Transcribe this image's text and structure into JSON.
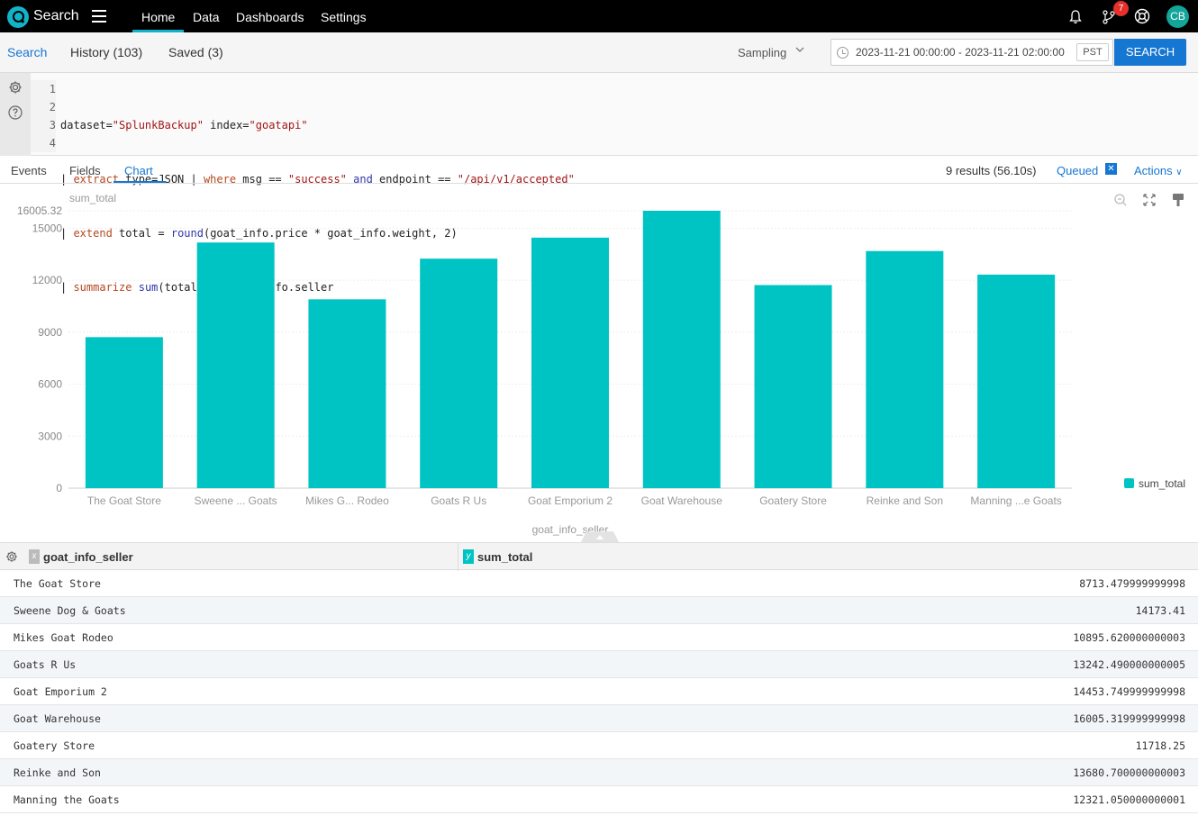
{
  "header": {
    "app_title": "Search",
    "nav": [
      "Home",
      "Data",
      "Dashboards",
      "Settings"
    ],
    "notification_count": "7",
    "avatar_initials": "CB"
  },
  "search_tabs": {
    "search": "Search",
    "history": "History (103)",
    "saved": "Saved (3)"
  },
  "sampling_label": "Sampling",
  "time_range": {
    "value": "2023-11-21 00:00:00 - 2023-11-21 02:00:00",
    "timezone": "PST"
  },
  "search_button": "SEARCH",
  "query": {
    "line_numbers": [
      "1",
      "2",
      "3",
      "4"
    ],
    "lines": [
      "dataset=\"SplunkBackup\" index=\"goatapi\"",
      "| extract type=JSON | where msg == \"success\" and endpoint == \"/api/v1/accepted\"",
      "| extend total = round(goat_info.price * goat_info.weight, 2)",
      "| summarize sum(total) by goat_info.seller"
    ]
  },
  "result_tabs": {
    "events": "Events",
    "fields": "Fields",
    "chart": "Chart"
  },
  "results_count": "9 results (56.10s)",
  "queued_label": "Queued",
  "actions_label": "Actions",
  "chart_data": {
    "type": "bar",
    "title": "",
    "xlabel": "goat_info_seller",
    "ylabel": "sum_total",
    "ylim": [
      0,
      16005.32
    ],
    "max_label": "16005.32",
    "y_ticks": [
      0,
      3000,
      6000,
      9000,
      12000,
      15000
    ],
    "categories": [
      "The Goat Store",
      "Sweene ... Goats",
      "Mikes G... Rodeo",
      "Goats R Us",
      "Goat Emporium 2",
      "Goat Warehouse",
      "Goatery Store",
      "Reinke and Son",
      "Manning ...e Goats"
    ],
    "series": [
      {
        "name": "sum_total",
        "values": [
          8713.48,
          14173.41,
          10895.62,
          13242.49,
          14453.75,
          16005.32,
          11718.25,
          13680.7,
          12321.05
        ]
      }
    ],
    "bar_color": "#00c4c4",
    "grid": true,
    "legend_position": "right"
  },
  "table": {
    "col_x_tag": "x",
    "col_y_tag": "y",
    "columns": [
      "goat_info_seller",
      "sum_total"
    ],
    "rows": [
      [
        "The Goat Store",
        "8713.479999999998"
      ],
      [
        "Sweene Dog & Goats",
        "14173.41"
      ],
      [
        "Mikes Goat Rodeo",
        "10895.620000000003"
      ],
      [
        "Goats R Us",
        "13242.490000000005"
      ],
      [
        "Goat Emporium 2",
        "14453.749999999998"
      ],
      [
        "Goat Warehouse",
        "16005.319999999998"
      ],
      [
        "Goatery Store",
        "11718.25"
      ],
      [
        "Reinke and Son",
        "13680.700000000003"
      ],
      [
        "Manning the Goats",
        "12321.050000000001"
      ]
    ]
  },
  "colors": {
    "accent": "#1677d2",
    "bar": "#00c4c4",
    "logo": "#11b3c9",
    "badge": "#e5302c"
  }
}
